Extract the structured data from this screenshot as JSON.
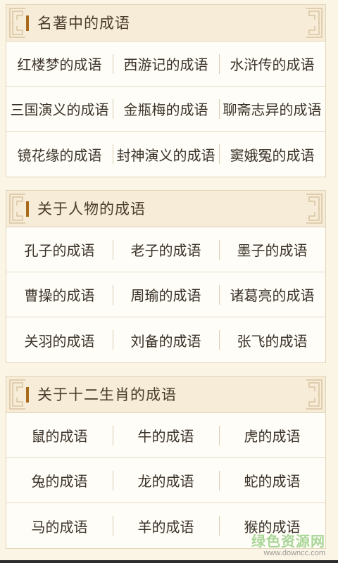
{
  "sections": [
    {
      "title": "名著中的成语",
      "rows": [
        [
          "红楼梦的成语",
          "西游记的成语",
          "水浒传的成语"
        ],
        [
          "三国演义的成语",
          "金瓶梅的成语",
          "聊斋志异的成语"
        ],
        [
          "镜花缘的成语",
          "封神演义的成语",
          "窦娥冤的成语"
        ]
      ]
    },
    {
      "title": "关于人物的成语",
      "rows": [
        [
          "孔子的成语",
          "老子的成语",
          "墨子的成语"
        ],
        [
          "曹操的成语",
          "周瑜的成语",
          "诸葛亮的成语"
        ],
        [
          "关羽的成语",
          "刘备的成语",
          "张飞的成语"
        ]
      ]
    },
    {
      "title": "关于十二生肖的成语",
      "rows": [
        [
          "鼠的成语",
          "牛的成语",
          "虎的成语"
        ],
        [
          "兔的成语",
          "龙的成语",
          "蛇的成语"
        ],
        [
          "马的成语",
          "羊的成语",
          "猴的成语"
        ]
      ]
    }
  ],
  "watermark": {
    "main": "绿色资源网",
    "sub": "www.downcc.com"
  },
  "colors": {
    "accent": "#a86a1c",
    "background": "#fbf5e6",
    "header": "#f6ecd8"
  }
}
